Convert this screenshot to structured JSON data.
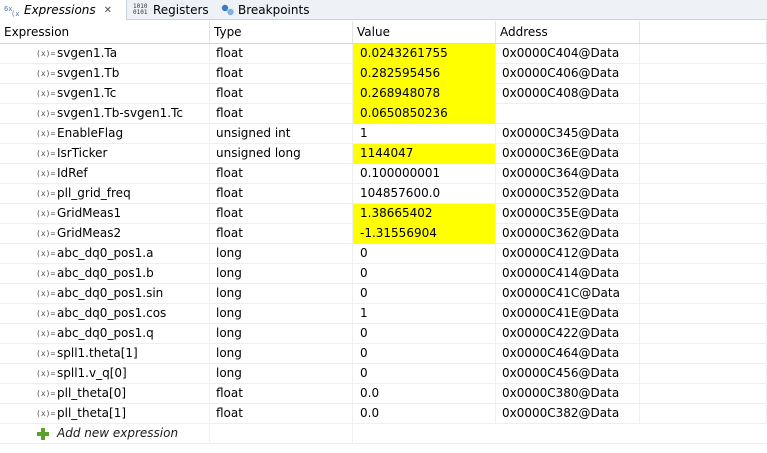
{
  "tabs": [
    {
      "label": "Expressions",
      "close": "✕",
      "icon": "expressions-icon"
    },
    {
      "label": "Registers",
      "icon": "registers-icon"
    },
    {
      "label": "Breakpoints",
      "icon": "breakpoints-icon"
    }
  ],
  "columns": [
    "Expression",
    "Type",
    "Value",
    "Address"
  ],
  "colors": {
    "highlight": "#ffff00",
    "add_icon": "#5aa02c"
  },
  "rows": [
    {
      "expr": "svgen1.Ta",
      "type": "float",
      "value": "0.0243261755",
      "address": "0x0000C404@Data",
      "changed": true
    },
    {
      "expr": "svgen1.Tb",
      "type": "float",
      "value": "0.282595456",
      "address": "0x0000C406@Data",
      "changed": true
    },
    {
      "expr": "svgen1.Tc",
      "type": "float",
      "value": "0.268948078",
      "address": "0x0000C408@Data",
      "changed": true
    },
    {
      "expr": "svgen1.Tb-svgen1.Tc",
      "type": "float",
      "value": "0.0650850236",
      "address": "",
      "changed": true
    },
    {
      "expr": "EnableFlag",
      "type": "unsigned int",
      "value": "1",
      "address": "0x0000C345@Data",
      "changed": false
    },
    {
      "expr": "IsrTicker",
      "type": "unsigned long",
      "value": "1144047",
      "address": "0x0000C36E@Data",
      "changed": true
    },
    {
      "expr": "IdRef",
      "type": "float",
      "value": "0.100000001",
      "address": "0x0000C364@Data",
      "changed": false
    },
    {
      "expr": "pll_grid_freq",
      "type": "float",
      "value": "104857600.0",
      "address": "0x0000C352@Data",
      "changed": false
    },
    {
      "expr": "GridMeas1",
      "type": "float",
      "value": "1.38665402",
      "address": "0x0000C35E@Data",
      "changed": true
    },
    {
      "expr": "GridMeas2",
      "type": "float",
      "value": "-1.31556904",
      "address": "0x0000C362@Data",
      "changed": true
    },
    {
      "expr": "abc_dq0_pos1.a",
      "type": "long",
      "value": "0",
      "address": "0x0000C412@Data",
      "changed": false
    },
    {
      "expr": "abc_dq0_pos1.b",
      "type": "long",
      "value": "0",
      "address": "0x0000C414@Data",
      "changed": false
    },
    {
      "expr": "abc_dq0_pos1.sin",
      "type": "long",
      "value": "0",
      "address": "0x0000C41C@Data",
      "changed": false
    },
    {
      "expr": "abc_dq0_pos1.cos",
      "type": "long",
      "value": "1",
      "address": "0x0000C41E@Data",
      "changed": false
    },
    {
      "expr": "abc_dq0_pos1.q",
      "type": "long",
      "value": "0",
      "address": "0x0000C422@Data",
      "changed": false
    },
    {
      "expr": "spll1.theta[1]",
      "type": "long",
      "value": "0",
      "address": "0x0000C464@Data",
      "changed": false
    },
    {
      "expr": "spll1.v_q[0]",
      "type": "long",
      "value": "0",
      "address": "0x0000C456@Data",
      "changed": false
    },
    {
      "expr": "pll_theta[0]",
      "type": "float",
      "value": "0.0",
      "address": "0x0000C380@Data",
      "changed": false
    },
    {
      "expr": "pll_theta[1]",
      "type": "float",
      "value": "0.0",
      "address": "0x0000C382@Data",
      "changed": false
    }
  ],
  "add_expression": {
    "label": "Add new expression",
    "icon": "plus-icon"
  }
}
